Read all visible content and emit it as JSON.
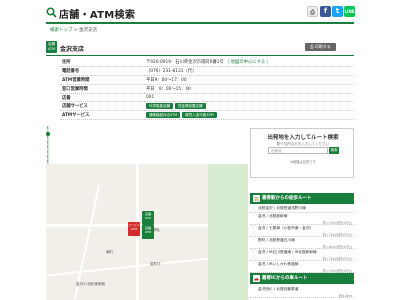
{
  "header": {
    "title": "店舗・ATM検索",
    "share": {
      "fb": "f",
      "tw": "t",
      "line": "LINE"
    }
  },
  "breadcrumb": {
    "top": "検索トップ",
    "sep": " > ",
    "current": "金沢支店"
  },
  "page": {
    "badge": "店舗\nATM",
    "title": "金沢支店",
    "print_label": "印刷する"
  },
  "info": {
    "rows": [
      {
        "key": "住所",
        "value": "〒920-0919　石川県金沢市南町6番1号",
        "link": "［ 地図の中心にする ］"
      },
      {
        "key": "電話番号",
        "value": "（076）231-8131（代）"
      },
      {
        "key": "ATM営業時間",
        "value": "平日9：00～17：00"
      },
      {
        "key": "窓口営業時間",
        "value": "平日　9：00～15：00"
      },
      {
        "key": "店番",
        "value": "001"
      },
      {
        "key": "店舗サービス",
        "tags": [
          "外貨取扱店舗",
          "貸金庫設置店舗"
        ]
      },
      {
        "key": "ATMサービス",
        "tags": [
          "通帳繰越対応ATM",
          "硬貨入金可能ATM"
        ]
      }
    ]
  },
  "map": {
    "labels": [
      "尾山神社",
      "南町",
      "香林坊",
      "金沢21世紀美術館"
    ],
    "pins": {
      "atm": "店舗\nATM",
      "red": "コンビニ\nATM",
      "green2": "店舗\nATM"
    }
  },
  "route": {
    "title": "出発地を入力してルート検索",
    "sub": "駅や住所などを入力してください",
    "placeholder": "出発地",
    "go": "検索",
    "note": "※経路は目安です"
  },
  "sections": [
    {
      "title": "最寄駅からの徒歩ルート",
      "items": [
        {
          "name": "北鉄金沢 / 北陸鉄道浅野川線",
          "dist": ""
        },
        {
          "name": "金沢 / 北陸新幹線",
          "dist": "約1.7km(徒歩22分)"
        },
        {
          "name": "金沢 / 七尾線（小松市東・金沢）",
          "dist": "約1.7km(徒歩22分)"
        },
        {
          "name": "野町 / 北陸鉄道石川線",
          "dist": "約1.8km(徒歩23分)"
        },
        {
          "name": "金沢 / IR石川鉄道線 / IR北陸新幹線",
          "dist": "約1.7km(徒歩22分)"
        },
        {
          "name": "金沢 / IRいしかわ鉄道線",
          "dist": "約1.7km(徒歩22分)"
        }
      ]
    },
    {
      "title": "最寄ICからの車ルート",
      "items": [
        {
          "name": "金沢西IC / 北陸自動車道",
          "dist": "約6.4km"
        }
      ]
    }
  ],
  "colors": {
    "accent": "#1a7f3c",
    "red": "#d12b2b"
  }
}
